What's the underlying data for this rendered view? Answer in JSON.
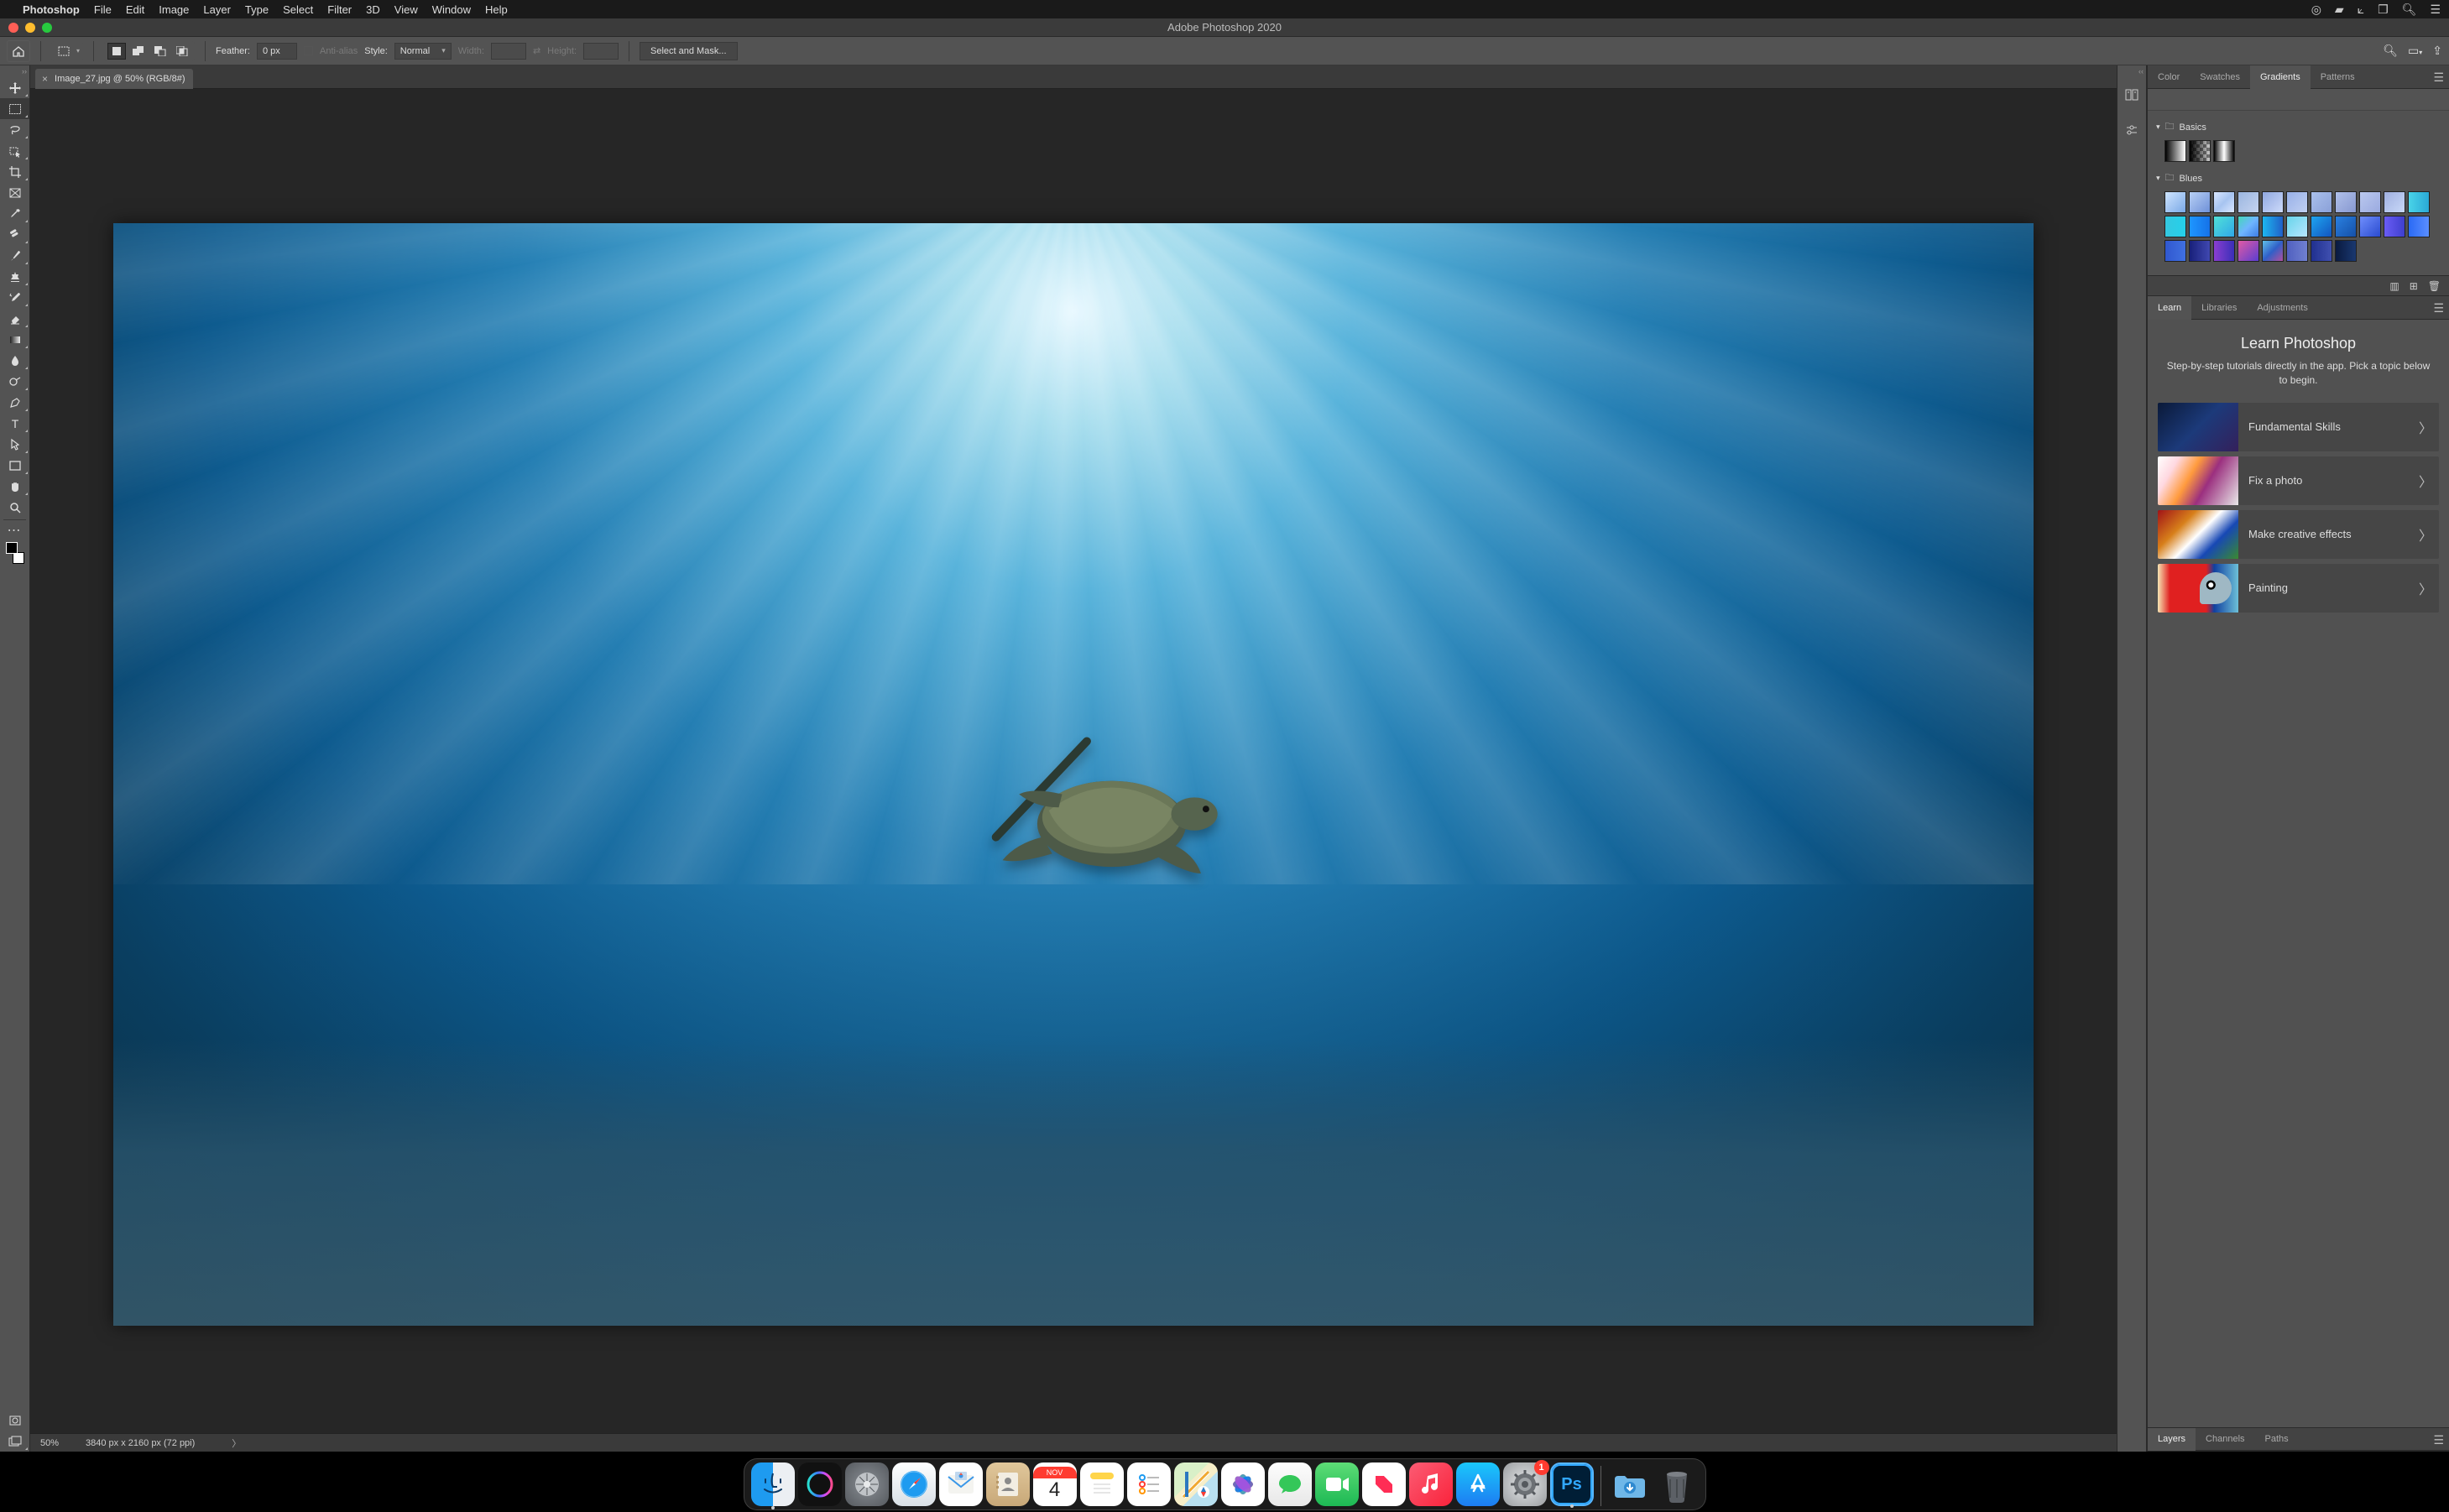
{
  "menubar": {
    "app_name": "Photoshop",
    "items": [
      "File",
      "Edit",
      "Image",
      "Layer",
      "Type",
      "Select",
      "Filter",
      "3D",
      "View",
      "Window",
      "Help"
    ]
  },
  "window": {
    "title": "Adobe Photoshop 2020"
  },
  "optionsbar": {
    "feather_label": "Feather:",
    "feather_value": "0 px",
    "antialias_label": "Anti-alias",
    "style_label": "Style:",
    "style_value": "Normal",
    "width_label": "Width:",
    "height_label": "Height:",
    "select_mask": "Select and Mask..."
  },
  "document": {
    "tab_label": "Image_27.jpg @ 50% (RGB/8#)",
    "zoom": "50%",
    "dims": "3840 px x 2160 px (72 ppi)"
  },
  "panels": {
    "top": {
      "tabs": [
        "Color",
        "Swatches",
        "Gradients",
        "Patterns"
      ],
      "active": 2
    },
    "gradients": {
      "folders": [
        "Basics",
        "Blues"
      ],
      "blues": [
        "linear-gradient(135deg,#cfe5ff,#7aa8e6)",
        "linear-gradient(135deg,#b8d0f5,#6e90d8)",
        "linear-gradient(135deg,#d9e6ff,#a7c4f0,#d9e6ff)",
        "linear-gradient(135deg,#9bb6e0,#c5d3ef)",
        "linear-gradient(135deg,#90a8e0,#cddafa)",
        "linear-gradient(135deg,#98b0e8,#c0d0f2)",
        "linear-gradient(135deg,#aac0ec,#8aa0d8)",
        "linear-gradient(135deg,#b0c0ea,#8798d0)",
        "linear-gradient(135deg,#bac8ee,#9aaae0)",
        "linear-gradient(135deg,#a0b0e0,#c8d8f8)",
        "linear-gradient(90deg,#49d3e8,#2aa9d6)",
        "linear-gradient(90deg,#34c8e0,#25d0ea)",
        "linear-gradient(90deg,#1e96ff,#1572e8)",
        "linear-gradient(135deg,#50e0d8,#30a8e8)",
        "linear-gradient(135deg,#43d7b8,#6fb5ff,#3d7de5)",
        "linear-gradient(90deg,#1db6f0,#2060c8)",
        "linear-gradient(135deg,#68d4ea,#b7e6ff)",
        "linear-gradient(135deg,#1ea5f0,#1255c0)",
        "linear-gradient(135deg,#2a80e0,#1550a8)",
        "linear-gradient(135deg,#6f8efc,#2a4bd0)",
        "linear-gradient(90deg,#6a5cf5,#3e3fce)",
        "linear-gradient(90deg,#2a6af5,#5a8eff)",
        "linear-gradient(90deg,#3058d0,#4070e0)",
        "linear-gradient(90deg,#18207a,#4048b0)",
        "linear-gradient(90deg,#8a3ed0,#3a2fb8)",
        "linear-gradient(135deg,#e05aa5,#5a3ed0)",
        "linear-gradient(135deg,#60c0e8,#3060c8,#b050a0)",
        "linear-gradient(90deg,#5060c0,#7080d0)",
        "linear-gradient(90deg,#203090,#4050b0)",
        "linear-gradient(90deg,#0a1a40,#1a3870)"
      ]
    },
    "mid": {
      "tabs": [
        "Learn",
        "Libraries",
        "Adjustments"
      ],
      "active": 0
    },
    "learn": {
      "title": "Learn Photoshop",
      "subtitle": "Step-by-step tutorials directly in the app. Pick a topic below to begin.",
      "items": [
        "Fundamental Skills",
        "Fix a photo",
        "Make creative effects",
        "Painting"
      ]
    },
    "bottom": {
      "tabs": [
        "Layers",
        "Channels",
        "Paths"
      ],
      "active": 0
    }
  },
  "dock": {
    "apps": [
      "finder",
      "siri",
      "launchpad",
      "safari",
      "mail",
      "contacts",
      "calendar",
      "notes",
      "reminders",
      "maps",
      "photos",
      "messages",
      "facetime",
      "news",
      "music",
      "appstore",
      "settings",
      "photoshop"
    ],
    "calendar": {
      "month": "NOV",
      "day": "4"
    },
    "badges": {
      "settings": "1"
    }
  }
}
